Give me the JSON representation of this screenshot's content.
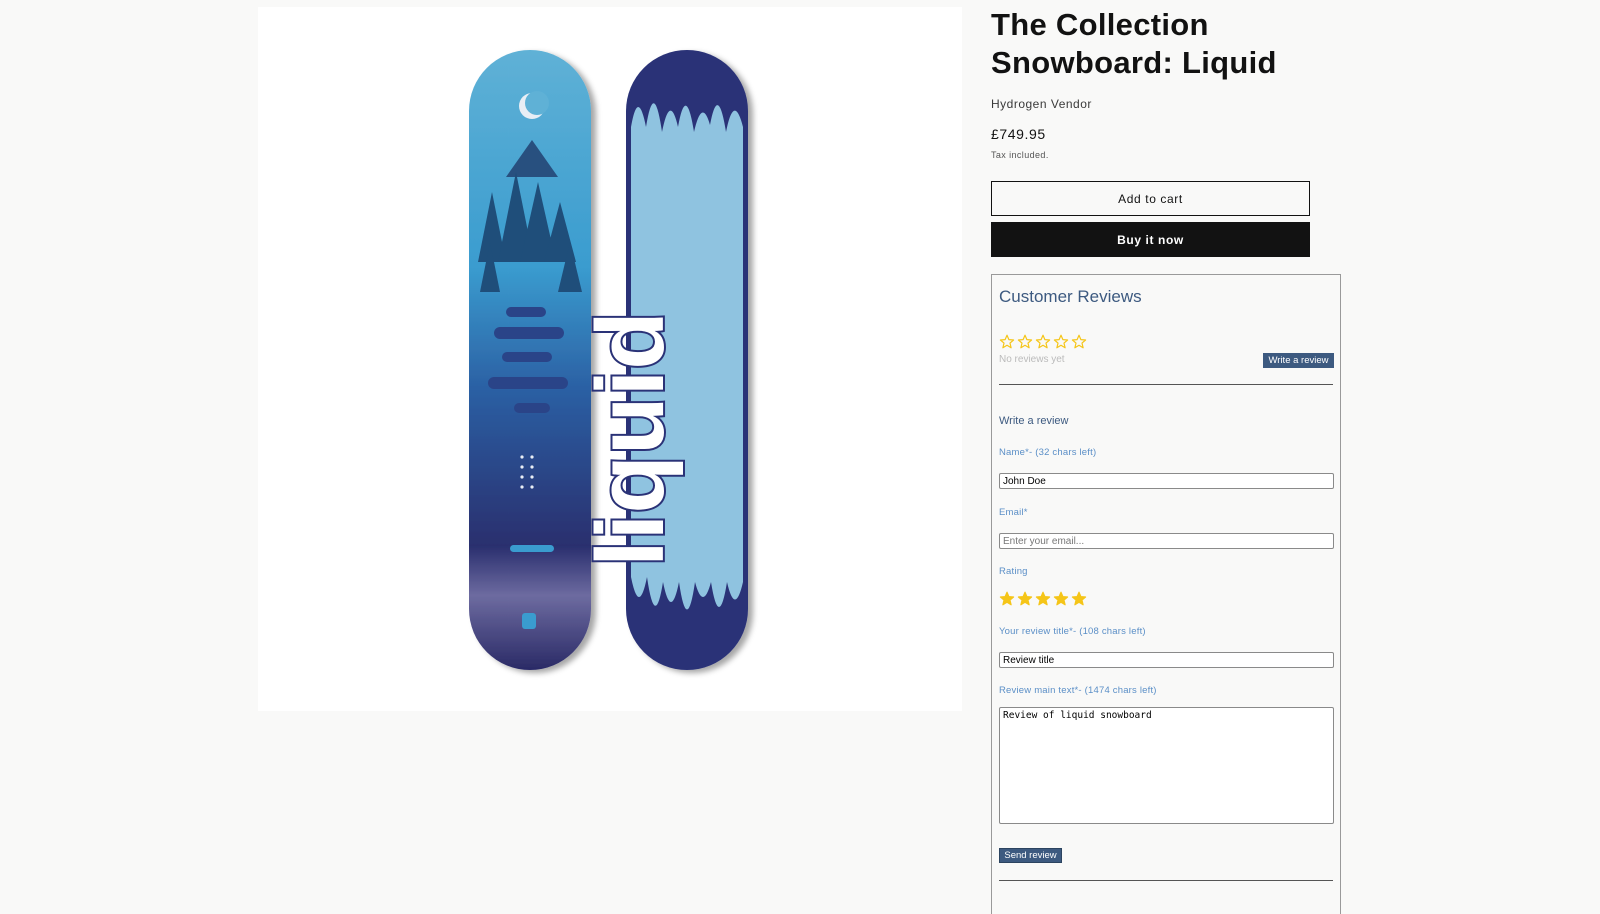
{
  "product": {
    "title": "The Collection Snowboard: Liquid",
    "vendor": "Hydrogen Vendor",
    "price": "£749.95",
    "tax_note": "Tax included.",
    "add_to_cart_label": "Add to cart",
    "buy_now_label": "Buy it now",
    "board_graphic_text": "liquid"
  },
  "reviews": {
    "title": "Customer Reviews",
    "average_rating": 0,
    "max_rating": 5,
    "no_reviews_text": "No reviews yet",
    "write_review_button": "Write a review",
    "form": {
      "heading": "Write a review",
      "name_label": "Name*- (32 chars left)",
      "name_value": "John Doe",
      "email_label": "Email*",
      "email_placeholder": "Enter your email...",
      "rating_label": "Rating",
      "rating_value": 5,
      "title_label": "Your review title*- (108 chars left)",
      "title_value": "Review title",
      "body_label": "Review main text*- (1474 chars left)",
      "body_value": "Review of liquid snowboard",
      "send_button": "Send review"
    }
  },
  "colors": {
    "accent": "#3d5a80",
    "label": "#5b8fc7",
    "star": "#f5c518",
    "button_dark": "#121212"
  }
}
